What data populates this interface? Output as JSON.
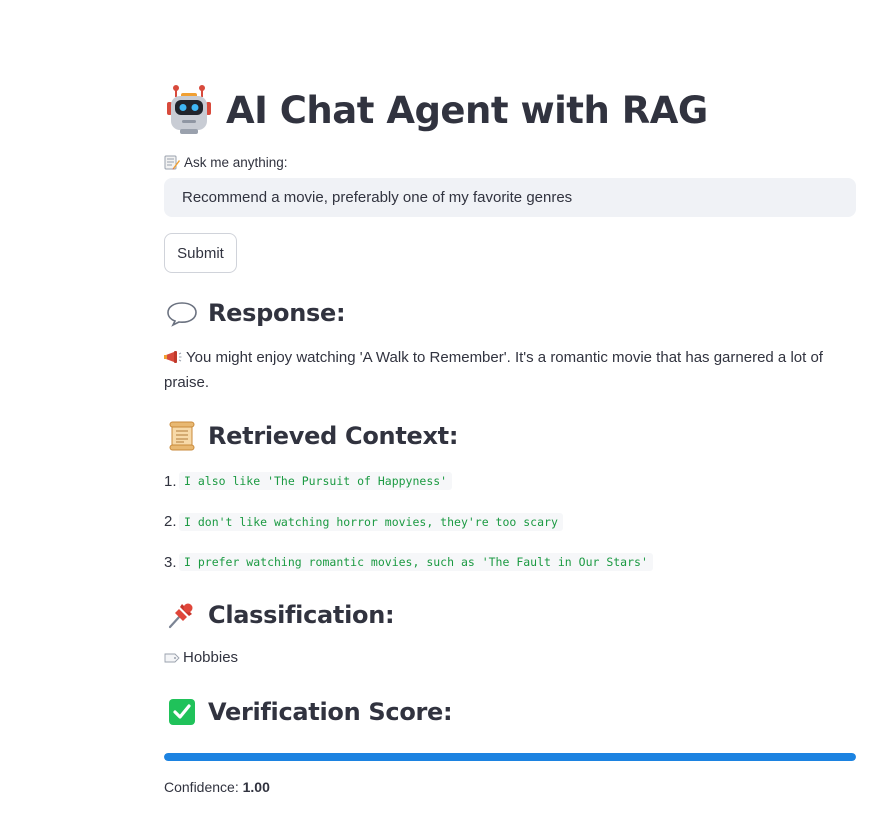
{
  "header": {
    "title": "AI Chat Agent with RAG",
    "icon": "robot-icon"
  },
  "query": {
    "label": "Ask me anything:",
    "label_icon": "memo-icon",
    "value": "Recommend a movie, preferably one of my favorite genres"
  },
  "submit": {
    "label": "Submit"
  },
  "response": {
    "heading": "Response:",
    "heading_icon": "speech-bubble-icon",
    "icon": "megaphone-icon",
    "text": "You might enjoy watching 'A Walk to Remember'. It's a romantic movie that has garnered a lot of praise."
  },
  "context": {
    "heading": "Retrieved Context:",
    "heading_icon": "scroll-icon",
    "items": [
      {
        "number": "1.",
        "text": "I also like 'The Pursuit of Happyness'"
      },
      {
        "number": "2.",
        "text": "I don't like watching horror movies, they're too scary"
      },
      {
        "number": "3.",
        "text": "I prefer watching romantic movies, such as 'The Fault in Our Stars'"
      }
    ]
  },
  "classification": {
    "heading": "Classification:",
    "heading_icon": "pushpin-icon",
    "icon": "label-tag-icon",
    "value": "Hobbies"
  },
  "verification": {
    "heading": "Verification Score:",
    "heading_icon": "check-mark-button-icon",
    "progress": 1.0,
    "confidence_label": "Confidence:",
    "confidence_value": "1.00"
  },
  "colors": {
    "accent": "#1c83e1",
    "code_text": "#1b9a42",
    "input_bg": "#f0f2f6",
    "text": "#31333f"
  }
}
